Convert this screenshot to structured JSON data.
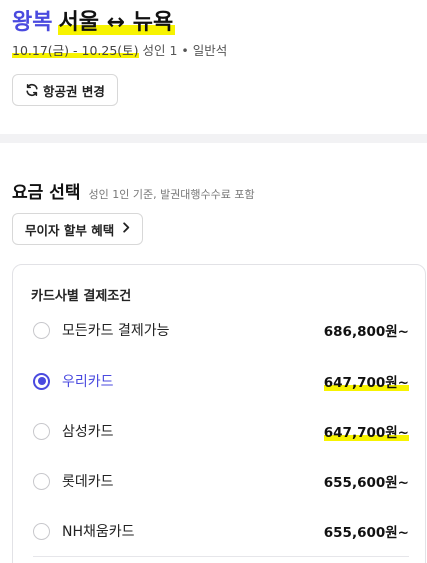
{
  "trip": {
    "type_label": "왕복",
    "route": "서울 ↔ 뉴욕",
    "dates": "10.17(금) - 10.25(토)",
    "pax_class": " 성인 1 • 일반석"
  },
  "change_button": {
    "label": "항공권 변경",
    "icon": "refresh-icon"
  },
  "fare": {
    "title": "요금 선택",
    "note": "성인 1인 기준, 발권대행수수료 포함"
  },
  "benefit_button": {
    "label": "무이자 할부 혜택",
    "icon": "chevron-right-icon"
  },
  "card_conditions": {
    "title": "카드사별 결제조건",
    "options": [
      {
        "label": "모든카드 결제가능",
        "price": "686,800원~",
        "selected": false,
        "highlighted": false
      },
      {
        "label": "우리카드",
        "price": "647,700원~",
        "selected": true,
        "highlighted": true
      },
      {
        "label": "삼성카드",
        "price": "647,700원~",
        "selected": false,
        "highlighted": true
      },
      {
        "label": "롯데카드",
        "price": "655,600원~",
        "selected": false,
        "highlighted": false
      },
      {
        "label": "NH채움카드",
        "price": "655,600원~",
        "selected": false,
        "highlighted": false
      }
    ]
  },
  "colors": {
    "accent": "#4a4adf",
    "highlight": "#f7f300",
    "divider": "#f2f2f4"
  }
}
